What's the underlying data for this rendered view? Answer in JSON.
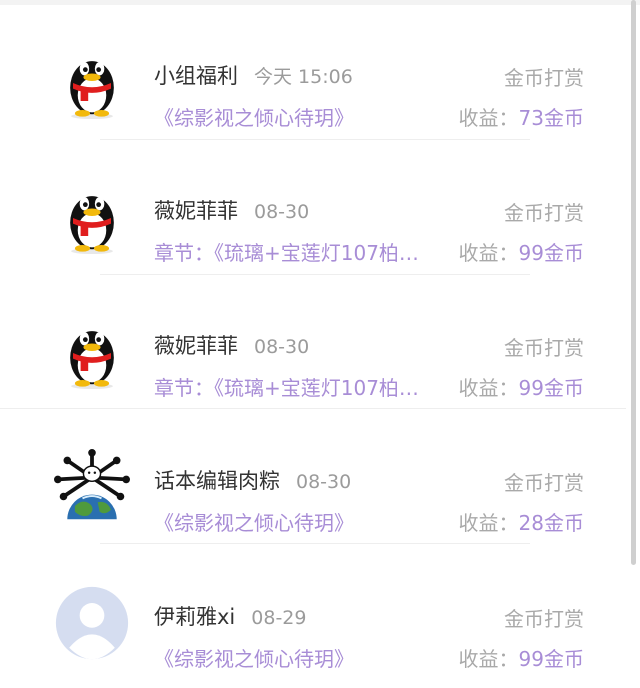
{
  "records": [
    {
      "name": "小组福利",
      "time": "今天 15:06",
      "type": "金币打赏",
      "detail": "《综影视之倾心待玥》",
      "income_label": "收益：",
      "income_value": "73金币",
      "avatar": "qq-penguin-avatar"
    },
    {
      "name": "薇妮菲菲",
      "time": "08-30",
      "type": "金币打赏",
      "detail": "章节：《琉璃+宝莲灯107柏…",
      "income_label": "收益：",
      "income_value": "99金币",
      "avatar": "qq-penguin-avatar"
    },
    {
      "name": "薇妮菲菲",
      "time": "08-30",
      "type": "金币打赏",
      "detail": "章节：《琉璃+宝莲灯107柏…",
      "income_label": "收益：",
      "income_value": "99金币",
      "avatar": "qq-penguin-avatar"
    },
    {
      "name": "话本编辑肉粽",
      "time": "08-30",
      "type": "金币打赏",
      "detail": "《综影视之倾心待玥》",
      "income_label": "收益：",
      "income_value": "28金币",
      "avatar": "earth-bones-avatar"
    },
    {
      "name": "伊莉雅xi",
      "time": "08-29",
      "type": "金币打赏",
      "detail": "《综影视之倾心待玥》",
      "income_label": "收益：",
      "income_value": "99金币",
      "avatar": "default-user-avatar"
    }
  ],
  "colors": {
    "accent": "#a88dd6",
    "muted": "#a9a9a9",
    "name": "#333333",
    "divider": "#eeeeee"
  }
}
